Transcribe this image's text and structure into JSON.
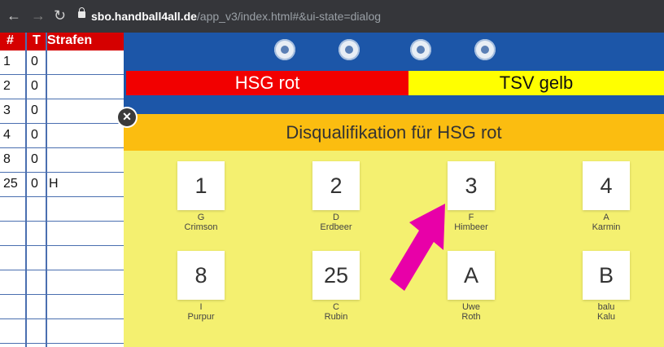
{
  "browser": {
    "url_host": "sbo.handball4all.de",
    "url_path": "/app_v3/index.html#&ui-state=dialog"
  },
  "left_table": {
    "headers": [
      "#",
      "T",
      "Strafen"
    ],
    "rows": [
      {
        "num": "1",
        "t": "0",
        "strafen": ""
      },
      {
        "num": "2",
        "t": "0",
        "strafen": ""
      },
      {
        "num": "3",
        "t": "0",
        "strafen": ""
      },
      {
        "num": "4",
        "t": "0",
        "strafen": ""
      },
      {
        "num": "8",
        "t": "0",
        "strafen": ""
      },
      {
        "num": "25",
        "t": "0",
        "strafen": "H"
      },
      {
        "num": "",
        "t": "",
        "strafen": ""
      },
      {
        "num": "",
        "t": "",
        "strafen": ""
      },
      {
        "num": "",
        "t": "",
        "strafen": ""
      },
      {
        "num": "",
        "t": "",
        "strafen": ""
      },
      {
        "num": "",
        "t": "",
        "strafen": ""
      },
      {
        "num": "",
        "t": "",
        "strafen": ""
      }
    ]
  },
  "teams": {
    "home": "HSG rot",
    "away": "TSV gelb",
    "home_color": "#f20000",
    "away_color": "#ffff00"
  },
  "dialog": {
    "title": "Disqualifikation für HSG rot",
    "close_icon": "close-icon",
    "players": [
      {
        "number": "1",
        "first": "G",
        "last": "Crimson"
      },
      {
        "number": "2",
        "first": "D",
        "last": "Erdbeer"
      },
      {
        "number": "3",
        "first": "F",
        "last": "Himbeer"
      },
      {
        "number": "4",
        "first": "A",
        "last": "Karmin"
      },
      {
        "number": "8",
        "first": "I",
        "last": "Purpur"
      },
      {
        "number": "25",
        "first": "C",
        "last": "Rubin"
      },
      {
        "number": "A",
        "first": "Uwe",
        "last": "Roth"
      },
      {
        "number": "B",
        "first": "balu",
        "last": "Kalu"
      }
    ]
  },
  "colors": {
    "topbar": "#1c56a8",
    "dialog_header": "#fbbd10",
    "dialog_body": "#f4f070",
    "arrow": "#e800a8"
  }
}
